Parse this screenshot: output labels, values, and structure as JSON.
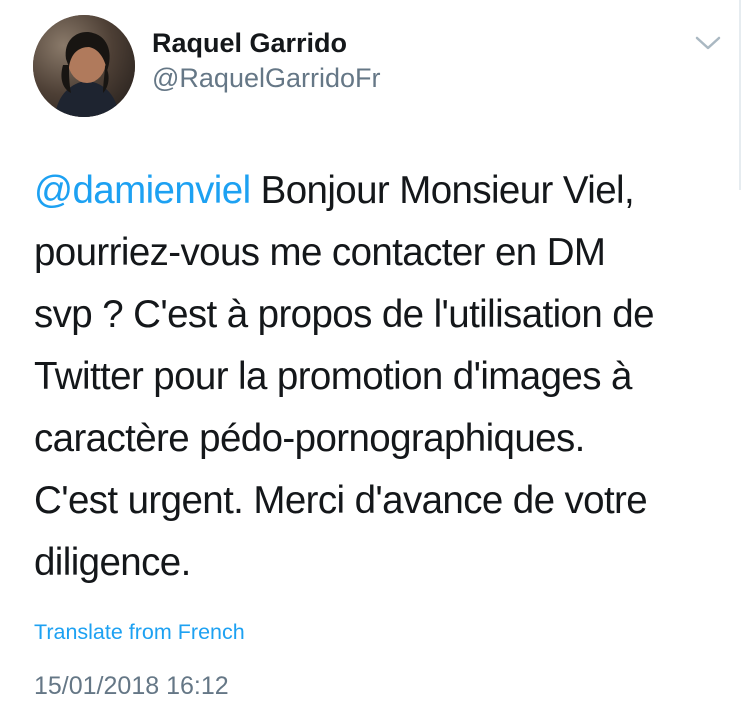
{
  "author": {
    "display_name": "Raquel Garrido",
    "handle": "@RaquelGarridoFr",
    "avatar_icon": "profile-photo"
  },
  "tweet": {
    "mention": "@damienviel",
    "line1_rest": " Bonjour Monsieur Viel,",
    "lines": [
      "pourriez-vous me contacter en DM",
      "svp ? C'est à propos de l'utilisation de",
      "Twitter pour la promotion d'images à",
      "caractère pédo-pornographiques.",
      "C'est urgent. Merci d'avance de votre",
      "diligence."
    ]
  },
  "translate_label": "Translate from French",
  "timestamp": "15/01/2018 16:12",
  "colors": {
    "link": "#1da1f2",
    "text": "#14171a",
    "secondary": "#657786"
  },
  "icons": {
    "menu": "chevron-down-icon"
  }
}
